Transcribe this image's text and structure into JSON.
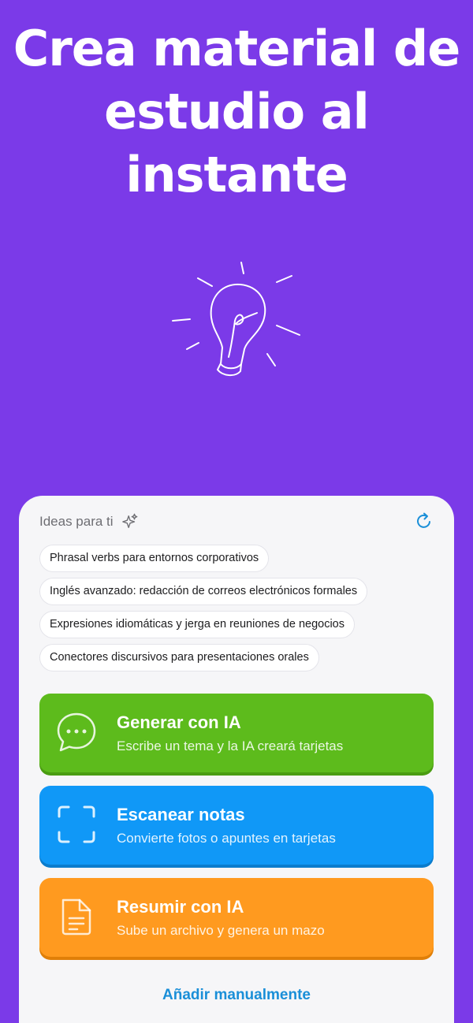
{
  "hero": {
    "title_line1": "Crea material de",
    "title_line2": "estudio al",
    "title_line3": "instante",
    "illustration_icon": "lightbulb-icon"
  },
  "ideas": {
    "title": "Ideas para ti",
    "title_icon": "sparkle-icon",
    "refresh_icon": "refresh-icon",
    "chips": [
      "Phrasal verbs para entornos corporativos",
      "Inglés avanzado: redacción de correos electrónicos formales",
      "Expresiones idiomáticas y jerga en reuniones de negocios",
      "Conectores discursivos para presentaciones orales"
    ]
  },
  "actions": {
    "generate": {
      "title": "Generar con IA",
      "subtitle": "Escribe un tema y la IA creará tarjetas",
      "icon": "chat-bubble-icon",
      "color": "#5dbb1c"
    },
    "scan": {
      "title": "Escanear notas",
      "subtitle": "Convierte fotos o apuntes en tarjetas",
      "icon": "scan-frame-icon",
      "color": "#1098f7"
    },
    "summarize": {
      "title": "Resumir con IA",
      "subtitle": "Sube un archivo y genera un mazo",
      "icon": "document-icon",
      "color": "#ff9a1f"
    }
  },
  "manual_link": "Añadir manualmente",
  "colors": {
    "background": "#7b3ae8",
    "card": "#f6f6f8",
    "link": "#1a8fd8"
  }
}
